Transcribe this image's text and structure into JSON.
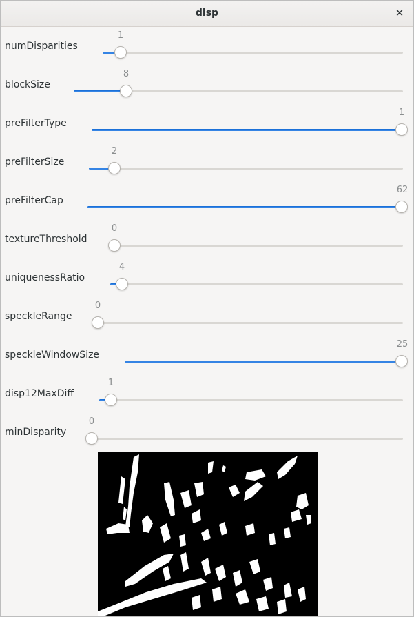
{
  "window": {
    "title": "disp"
  },
  "icons": {
    "close": "close-icon"
  },
  "trackbars": [
    {
      "label": "numDisparities",
      "value": "1",
      "position": 0.06
    },
    {
      "label": "blockSize",
      "value": "8",
      "position": 0.16
    },
    {
      "label": "preFilterType",
      "value": "1",
      "position": 1.0
    },
    {
      "label": "preFilterSize",
      "value": "2",
      "position": 0.08
    },
    {
      "label": "preFilterCap",
      "value": "62",
      "position": 1.0
    },
    {
      "label": "textureThreshold",
      "value": "0",
      "position": 0.0
    },
    {
      "label": "uniquenessRatio",
      "value": "4",
      "position": 0.04
    },
    {
      "label": "speckleRange",
      "value": "0",
      "position": 0.0
    },
    {
      "label": "speckleWindowSize",
      "value": "25",
      "position": 1.0
    },
    {
      "label": "disp12MaxDiff",
      "value": "1",
      "position": 0.04
    },
    {
      "label": "minDisparity",
      "value": "0",
      "position": 0.0
    }
  ],
  "colors": {
    "accent": "#3584e4",
    "trough": "#d9d7d3",
    "image_bg": "#000000",
    "image_fg": "#ffffff"
  }
}
